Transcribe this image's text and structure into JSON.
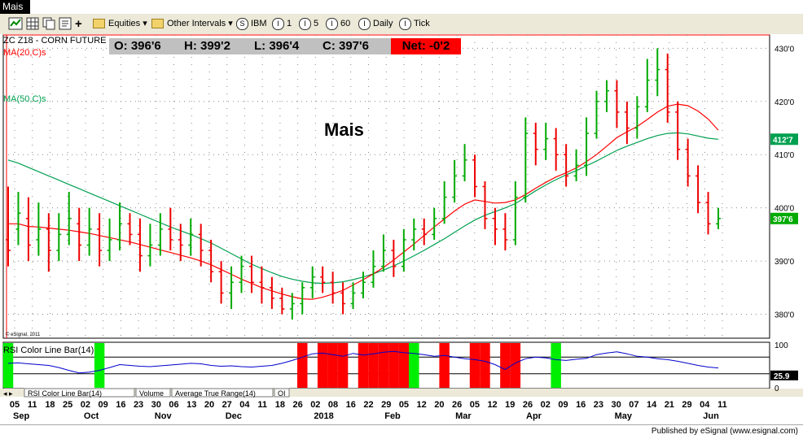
{
  "window": {
    "tab_title": "Mais"
  },
  "toolbar": {
    "equities": "Equities",
    "other_intervals": "Other Intervals",
    "intervals": [
      "IBM",
      "1",
      "5",
      "60",
      "Daily",
      "Tick"
    ],
    "interval_icons": [
      "S",
      "I",
      "I",
      "I",
      "I",
      "I"
    ]
  },
  "quote": {
    "symbol": "ZC Z18 - CORN FUTURE",
    "open": "O:  396'6",
    "high": "H:  399'2",
    "low": "L:  396'4",
    "close": "C:  397'6",
    "net": "Net:  -0'2"
  },
  "indicators": {
    "ma20": "MA(20,C)s",
    "ma50": "MA(50,C)s",
    "ma50_value": "412'7",
    "close_value": "397'6"
  },
  "annotation": "Mais",
  "watermark": "© eSignal, 2011",
  "rsi": {
    "title": "RSI Color Line Bar(14)",
    "upper_label": "100",
    "value_label": "25.9",
    "lower_label": "0"
  },
  "bottom_tabs": [
    "RSI Color Line Bar(14)",
    "Volume",
    "Average True Range(14)",
    "OI"
  ],
  "footer": {
    "published": "Published by eSignal (www.esignal.com)"
  },
  "colors": {
    "ma20": "#ff0000",
    "ma50": "#00a050",
    "up_bar": "#00aa00",
    "down_bar": "#ee0000",
    "rsi_line": "#0000cc",
    "rsi_overbought": "#ff0000",
    "rsi_oversold": "#00ee00"
  },
  "chart_data": {
    "type": "bar",
    "title": "ZC Z18 - CORN FUTURE",
    "interval": "Daily",
    "y_ticks": [
      "430'0",
      "420'0",
      "410'0",
      "400'0",
      "390'0",
      "380'0"
    ],
    "y_tick_values": [
      430,
      420,
      410,
      400,
      390,
      380
    ],
    "ylim": [
      375.5,
      432.5
    ],
    "x_day_labels": [
      "05",
      "11",
      "18",
      "25",
      "02",
      "09",
      "16",
      "23",
      "30",
      "06",
      "13",
      "20",
      "27",
      "04",
      "11",
      "18",
      "26",
      "02",
      "08",
      "16",
      "22",
      "29",
      "05",
      "12",
      "20",
      "26",
      "05",
      "12",
      "19",
      "26",
      "02",
      "09",
      "16",
      "23",
      "30",
      "07",
      "14",
      "21",
      "29",
      "04",
      "11"
    ],
    "x_month_labels": [
      {
        "label": "Sep",
        "day_index": 0
      },
      {
        "label": "Oct",
        "day_index": 4
      },
      {
        "label": "Nov",
        "day_index": 8
      },
      {
        "label": "Dec",
        "day_index": 12
      },
      {
        "label": "2018",
        "day_index": 17
      },
      {
        "label": "Feb",
        "day_index": 21
      },
      {
        "label": "Mar",
        "day_index": 25
      },
      {
        "label": "Apr",
        "day_index": 29
      },
      {
        "label": "May",
        "day_index": 34
      },
      {
        "label": "Jun",
        "day_index": 39
      }
    ],
    "price_bars": [
      [
        394,
        392,
        404,
        389
      ],
      [
        396,
        399,
        403,
        393
      ],
      [
        398,
        393,
        402,
        390
      ],
      [
        394,
        396,
        401,
        391
      ],
      [
        396,
        392,
        399,
        388
      ],
      [
        392,
        395,
        399,
        390
      ],
      [
        395,
        398,
        403,
        393
      ],
      [
        397,
        393,
        400,
        390
      ],
      [
        393,
        396,
        400,
        391
      ],
      [
        396,
        392,
        399,
        389
      ],
      [
        392,
        394,
        398,
        390
      ],
      [
        394,
        397,
        401,
        392
      ],
      [
        397,
        395,
        399,
        393
      ],
      [
        395,
        391,
        398,
        388
      ],
      [
        391,
        393,
        397,
        389
      ],
      [
        393,
        396,
        399,
        391
      ],
      [
        396,
        394,
        400,
        392
      ],
      [
        394,
        393,
        397,
        390
      ],
      [
        393,
        395,
        398,
        391
      ],
      [
        395,
        392,
        397,
        389
      ],
      [
        392,
        388,
        394,
        386
      ],
      [
        388,
        384,
        390,
        382
      ],
      [
        384,
        386,
        389,
        381
      ],
      [
        386,
        389,
        391,
        384
      ],
      [
        389,
        386,
        391,
        384
      ],
      [
        386,
        385,
        389,
        382
      ],
      [
        385,
        383,
        387,
        381
      ],
      [
        383,
        381,
        385,
        380
      ],
      [
        381,
        382,
        384,
        379
      ],
      [
        382,
        385,
        386,
        380
      ],
      [
        385,
        387,
        389,
        383
      ],
      [
        387,
        386,
        389,
        384
      ],
      [
        386,
        384,
        388,
        382
      ],
      [
        384,
        382,
        386,
        380
      ],
      [
        382,
        384,
        386,
        381
      ],
      [
        384,
        386,
        388,
        383
      ],
      [
        386,
        389,
        392,
        385
      ],
      [
        389,
        392,
        395,
        388
      ],
      [
        392,
        389,
        394,
        387
      ],
      [
        389,
        394,
        396,
        388
      ],
      [
        394,
        396,
        398,
        392
      ],
      [
        396,
        395,
        398,
        393
      ],
      [
        395,
        398,
        400,
        394
      ],
      [
        398,
        402,
        405,
        397
      ],
      [
        402,
        406,
        409,
        401
      ],
      [
        406,
        409,
        412,
        405
      ],
      [
        409,
        404,
        410,
        402
      ],
      [
        404,
        398,
        405,
        396
      ],
      [
        398,
        396,
        400,
        393
      ],
      [
        396,
        394,
        399,
        392
      ],
      [
        394,
        402,
        405,
        393
      ],
      [
        402,
        414,
        417,
        401
      ],
      [
        414,
        411,
        416,
        408
      ],
      [
        411,
        413,
        416,
        409
      ],
      [
        413,
        410,
        415,
        407
      ],
      [
        410,
        406,
        412,
        404
      ],
      [
        406,
        408,
        411,
        405
      ],
      [
        408,
        414,
        417,
        406
      ],
      [
        414,
        420,
        422,
        413
      ],
      [
        420,
        422,
        424,
        418
      ],
      [
        422,
        418,
        424,
        415
      ],
      [
        418,
        415,
        420,
        412
      ],
      [
        415,
        419,
        421,
        413
      ],
      [
        419,
        424,
        428,
        418
      ],
      [
        424,
        426,
        430,
        421
      ],
      [
        426,
        418,
        429,
        416
      ],
      [
        418,
        411,
        420,
        409
      ],
      [
        411,
        406,
        413,
        404
      ],
      [
        406,
        401,
        408,
        399
      ],
      [
        401,
        397,
        403,
        395
      ],
      [
        397,
        398,
        400,
        396
      ]
    ],
    "ma20": [
      397,
      397,
      396.5,
      396.4,
      396.2,
      396,
      395.8,
      395.5,
      395.2,
      394.8,
      394.4,
      394,
      393.6,
      393.1,
      392.6,
      392.1,
      391.6,
      391.1,
      390.6,
      390,
      389.3,
      388.4,
      387.5,
      386.6,
      385.8,
      385,
      384.4,
      383.8,
      383.3,
      382.9,
      382.8,
      383.2,
      383.8,
      384.5,
      385.5,
      386.5,
      387.6,
      388.8,
      390.2,
      391.7,
      393.2,
      394.8,
      396.4,
      397.9,
      399.4,
      400.7,
      401.5,
      401.2,
      400.9,
      401,
      401.5,
      402.5,
      403.7,
      404.8,
      405.8,
      406.6,
      407.5,
      408.7,
      410,
      411.6,
      413.2,
      414.3,
      415.3,
      416.6,
      418,
      419.1,
      419.5,
      419.2,
      418.2,
      416.7,
      414.6
    ],
    "ma50": [
      409,
      408.4,
      407.6,
      406.8,
      406,
      405.2,
      404.4,
      403.6,
      402.8,
      402,
      401.2,
      400.4,
      399.6,
      398.8,
      398,
      397.2,
      396.4,
      395.7,
      395,
      394.2,
      393.4,
      392.4,
      391.4,
      390.4,
      389.4,
      388.6,
      387.8,
      387.1,
      386.6,
      386.2,
      385.9,
      385.8,
      385.9,
      386.1,
      386.5,
      387,
      387.6,
      388.3,
      389.1,
      390,
      391,
      392,
      393.1,
      394.2,
      395.4,
      396.6,
      397.7,
      398.6,
      399.3,
      400,
      400.8,
      402,
      403.2,
      404.3,
      405.3,
      406.2,
      407,
      407.9,
      408.8,
      409.8,
      410.8,
      411.6,
      412.3,
      413,
      413.6,
      414,
      414.1,
      413.9,
      413.5,
      413.1,
      412.9
    ],
    "rsi_values": [
      55,
      56,
      54,
      52,
      50,
      45,
      38,
      32,
      34,
      38,
      45,
      52,
      50,
      48,
      47,
      49,
      51,
      53,
      55,
      54,
      50,
      48,
      49,
      47,
      46,
      48,
      50,
      55,
      62,
      70,
      78,
      80,
      76,
      72,
      79,
      75,
      78,
      82,
      84,
      81,
      79,
      76,
      72,
      74,
      70,
      66,
      64,
      60,
      52,
      40,
      56,
      66,
      70,
      68,
      64,
      62,
      65,
      67,
      76,
      80,
      83,
      78,
      72,
      70,
      66,
      64,
      60,
      55,
      50,
      46,
      44
    ],
    "rsi_overbought_bars": [
      29,
      31,
      32,
      33,
      35,
      36,
      37,
      38,
      39,
      43,
      46,
      47,
      49,
      50
    ],
    "rsi_oversold_bars": [
      0,
      9,
      40,
      54
    ],
    "rsi_value": 25.9
  }
}
